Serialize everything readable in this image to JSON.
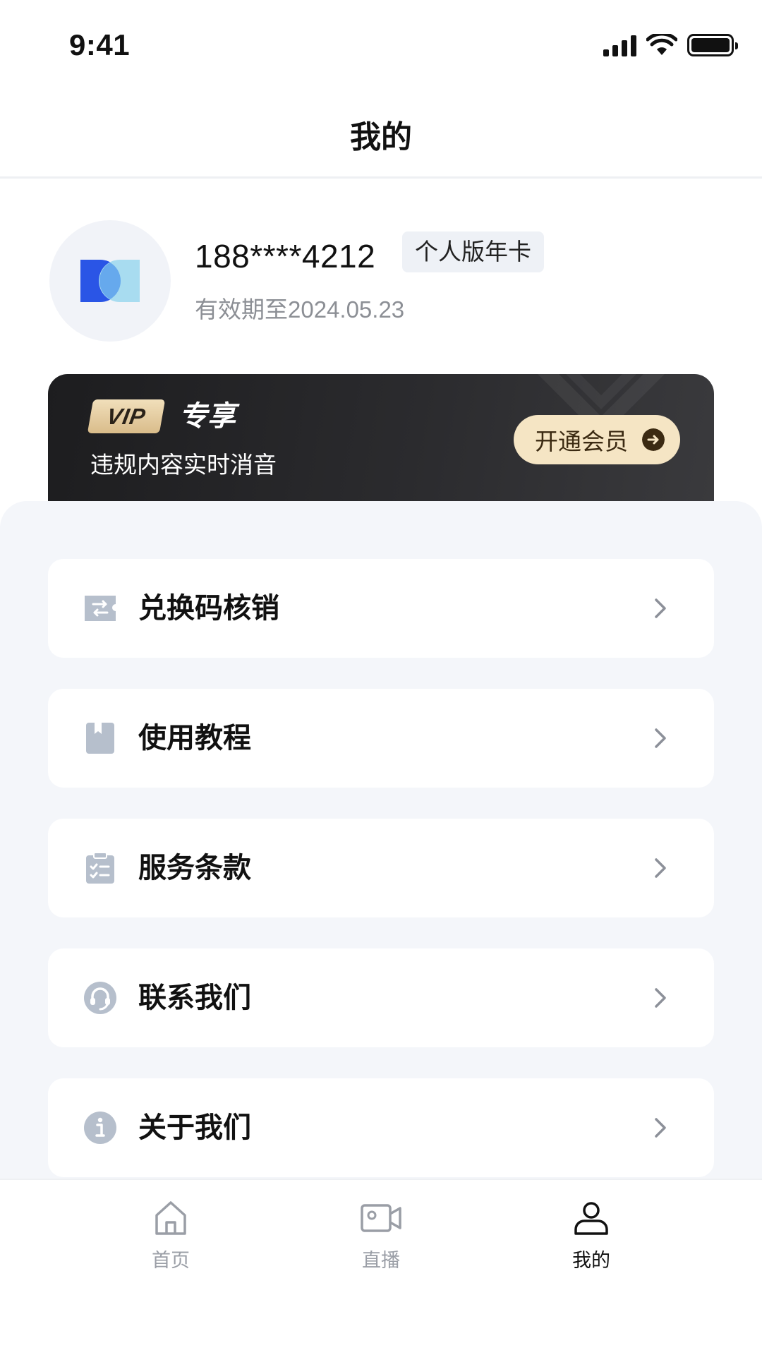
{
  "status_bar": {
    "time": "9:41"
  },
  "header": {
    "title": "我的"
  },
  "profile": {
    "phone": "188****4212",
    "plan": "个人版年卡",
    "expiry": "有效期至2024.05.23"
  },
  "vip_banner": {
    "tag": "VIP",
    "exclusive": "专享",
    "description": "违规内容实时消音",
    "button_label": "开通会员",
    "colors": {
      "tag_gold": "#e8d2a6",
      "button_bg": "#f5e5c4",
      "banner_bg": "#1d1d1f"
    }
  },
  "menu": {
    "items": [
      {
        "label": "兑换码核销",
        "icon": "ticket-exchange-icon"
      },
      {
        "label": "使用教程",
        "icon": "book-icon"
      },
      {
        "label": "服务条款",
        "icon": "clipboard-check-icon"
      },
      {
        "label": "联系我们",
        "icon": "headset-icon"
      },
      {
        "label": "关于我们",
        "icon": "info-icon"
      }
    ]
  },
  "tab_bar": {
    "tabs": [
      {
        "label": "首页",
        "icon": "home-icon",
        "active": false
      },
      {
        "label": "直播",
        "icon": "video-camera-icon",
        "active": false
      },
      {
        "label": "我的",
        "icon": "user-icon",
        "active": true
      }
    ]
  },
  "colors": {
    "panel_bg": "#f4f6fa",
    "icon_gray": "#b6bfcc",
    "accent_blue": "#2a55e6"
  }
}
